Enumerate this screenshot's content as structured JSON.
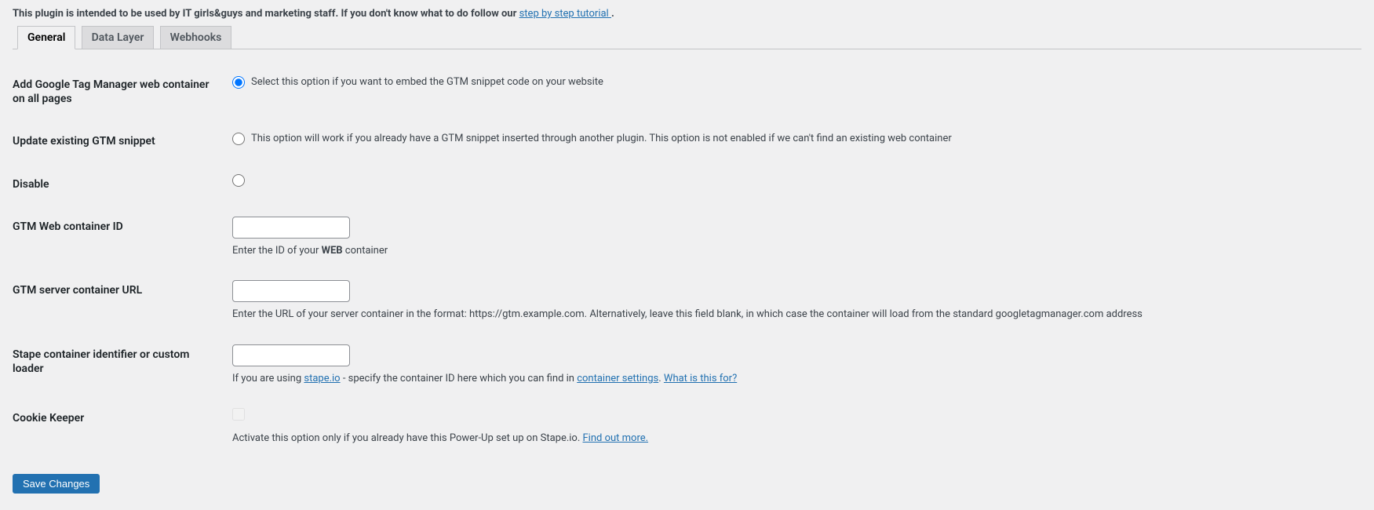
{
  "intro": {
    "prefix": "This plugin is intended to be used by IT girls&guys and marketing staff. If you don't know what to do follow our ",
    "link_text": "step by step tutorial ",
    "suffix": "."
  },
  "tabs": [
    {
      "label": "General",
      "active": true
    },
    {
      "label": "Data Layer",
      "active": false
    },
    {
      "label": "Webhooks",
      "active": false
    }
  ],
  "rows": {
    "add_container": {
      "label": "Add Google Tag Manager web container on all pages",
      "option": "Select this option if you want to embed the GTM snippet code on your website"
    },
    "update_existing": {
      "label": "Update existing GTM snippet",
      "option": "This option will work if you already have a GTM snippet inserted through another plugin. This option is not enabled if we can't find an existing web container"
    },
    "disable": {
      "label": "Disable"
    },
    "web_id": {
      "label": "GTM Web container ID",
      "value": "",
      "desc_prefix": "Enter the ID of your ",
      "desc_bold": "WEB",
      "desc_suffix": " container"
    },
    "server_url": {
      "label": "GTM server container URL",
      "value": "",
      "desc": "Enter the URL of your server container in the format: https://gtm.example.com. Alternatively, leave this field blank, in which case the container will load from the standard googletagmanager.com address"
    },
    "stape_id": {
      "label": "Stape container identifier or custom loader",
      "value": "",
      "desc_p1": "If you are using ",
      "desc_link1": "stape.io",
      "desc_p2": " - specify the container ID here which you can find in ",
      "desc_link2": "container settings",
      "desc_p3": ". ",
      "desc_link3": "What is this for?"
    },
    "cookie_keeper": {
      "label": "Cookie Keeper",
      "desc_p1": "Activate this option only if you already have this Power-Up set up on Stape.io. ",
      "desc_link": "Find out more."
    }
  },
  "submit": {
    "label": "Save Changes"
  }
}
